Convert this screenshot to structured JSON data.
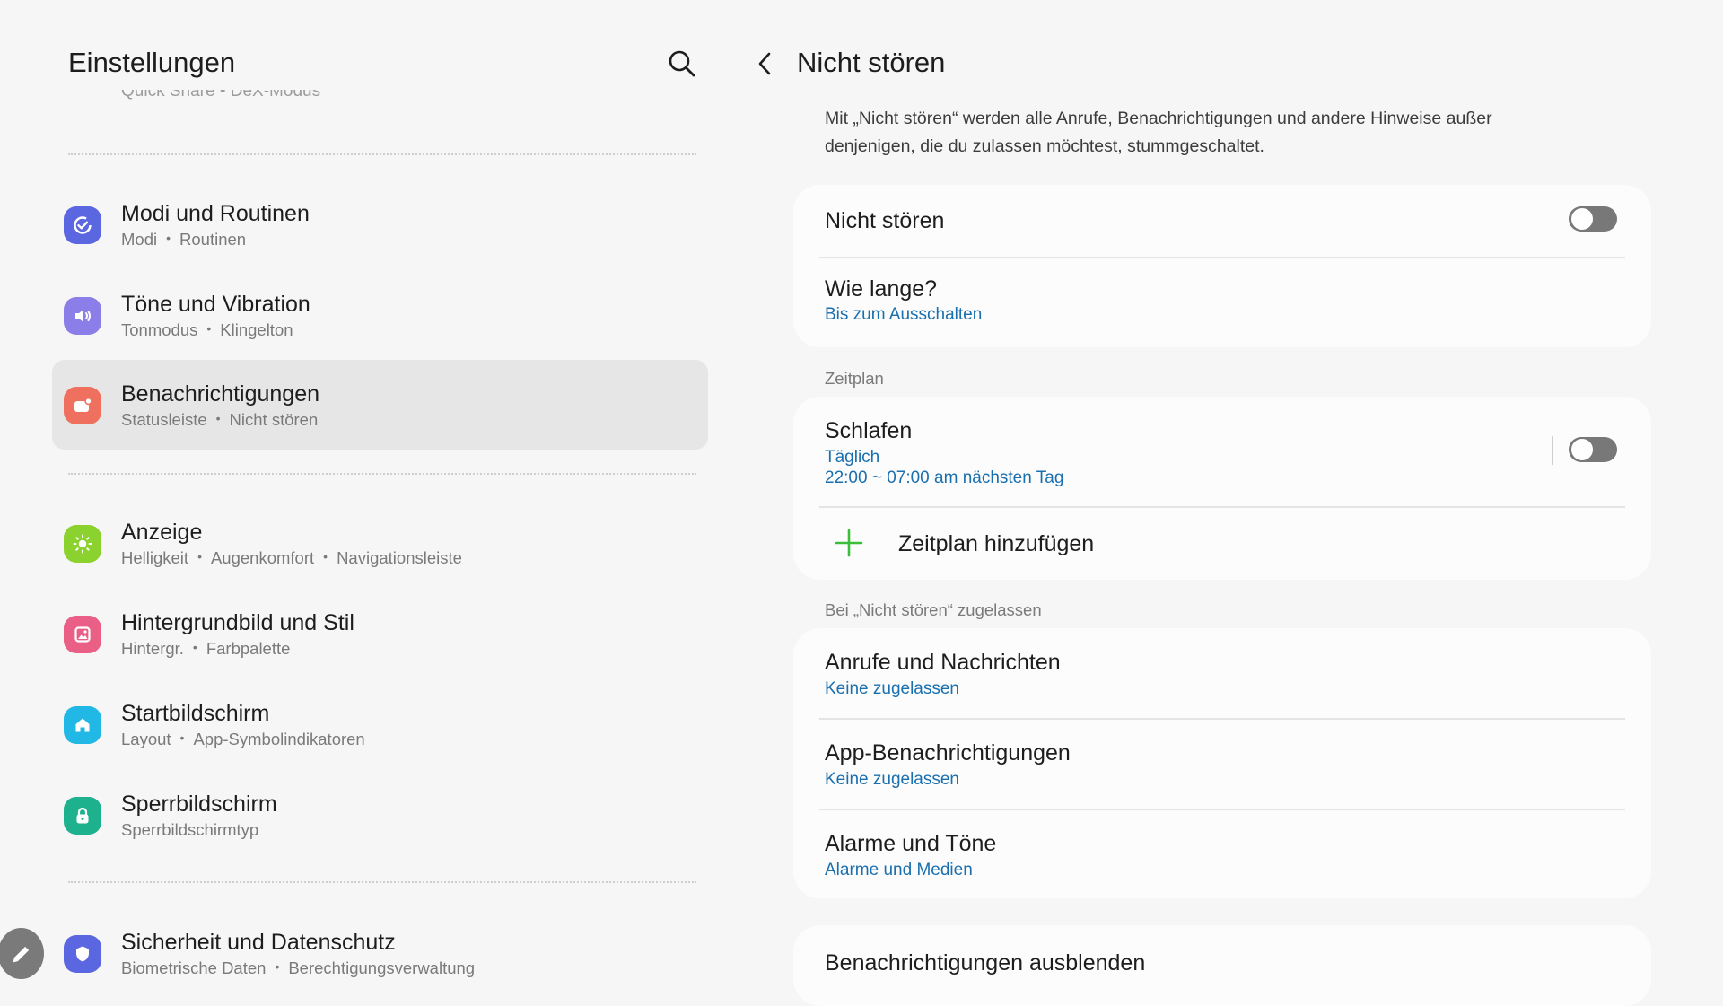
{
  "left": {
    "title": "Einstellungen",
    "ghost_sub": "Quick Share  •  DeX-Modus",
    "items": [
      {
        "title": "Modi und Routinen",
        "subs": [
          "Modi",
          "Routinen"
        ],
        "icon": "modes-icon",
        "color": "#5b67e0"
      },
      {
        "title": "Töne und Vibration",
        "subs": [
          "Tonmodus",
          "Klingelton"
        ],
        "icon": "sound-icon",
        "color": "#8b7ee8"
      },
      {
        "title": "Benachrichtigungen",
        "subs": [
          "Statusleiste",
          "Nicht stören"
        ],
        "icon": "notifications-icon",
        "color": "#f0705f"
      },
      {
        "title": "Anzeige",
        "subs": [
          "Helligkeit",
          "Augenkomfort",
          "Navigationsleiste"
        ],
        "icon": "display-icon",
        "color": "#8cd22e"
      },
      {
        "title": "Hintergrundbild und Stil",
        "subs": [
          "Hintergr.",
          "Farbpalette"
        ],
        "icon": "wallpaper-icon",
        "color": "#ea5f86"
      },
      {
        "title": "Startbildschirm",
        "subs": [
          "Layout",
          "App-Symbolindikatoren"
        ],
        "icon": "home-icon",
        "color": "#22b8e6"
      },
      {
        "title": "Sperrbildschirm",
        "subs": [
          "Sperrbildschirmtyp"
        ],
        "icon": "lock-icon",
        "color": "#1db18e"
      },
      {
        "title": "Sicherheit und Datenschutz",
        "subs": [
          "Biometrische Daten",
          "Berechtigungsverwaltung"
        ],
        "icon": "shield-icon",
        "color": "#5b67e0"
      }
    ]
  },
  "right": {
    "title": "Nicht stören",
    "description": "Mit „Nicht stören“ werden alle Anrufe, Benachrichtigungen und andere Hinweise außer denjenigen, die du zulassen möchtest, stummgeschaltet.",
    "dnd": {
      "label": "Nicht stören",
      "on": false
    },
    "duration": {
      "label": "Wie lange?",
      "value": "Bis zum Ausschalten"
    },
    "schedule_label": "Zeitplan",
    "sleep": {
      "label": "Schlafen",
      "days": "Täglich",
      "time": "22:00 ~ 07:00 am nächsten Tag",
      "on": false
    },
    "add_schedule": "Zeitplan hinzufügen",
    "allowed_label": "Bei „Nicht stören“ zugelassen",
    "allowed": [
      {
        "label": "Anrufe und Nachrichten",
        "value": "Keine zugelassen"
      },
      {
        "label": "App-Benachrichtigungen",
        "value": "Keine zugelassen"
      },
      {
        "label": "Alarme und Töne",
        "value": "Alarme und Medien"
      }
    ],
    "hide_notifications": "Benachrichtigungen ausblenden"
  },
  "colors": {
    "link": "#1a6fae",
    "toggle_off": "#787878",
    "accent_plus": "#3bbf3b"
  }
}
